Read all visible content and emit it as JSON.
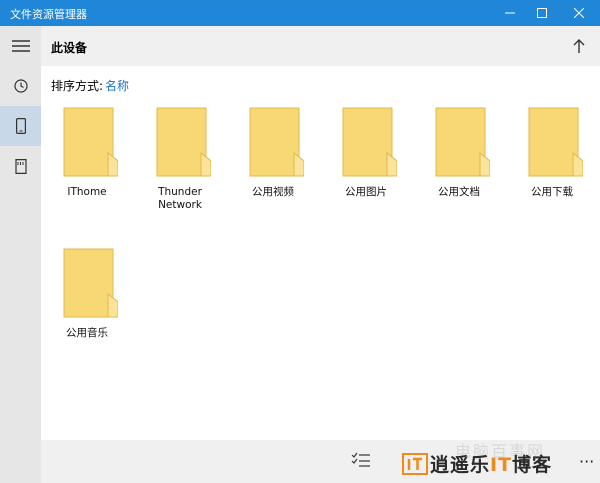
{
  "window": {
    "title": "文件资源管理器",
    "colors": {
      "titlebar": "#1f86d8",
      "accent": "#1a73c9",
      "sidebar": "#e6e6e6",
      "header": "#f0f0f0",
      "folder": "#f8d775"
    }
  },
  "sidebar": {
    "items": [
      {
        "icon": "hamburger-menu-icon"
      },
      {
        "icon": "clock-icon"
      },
      {
        "icon": "phone-icon",
        "active": true
      },
      {
        "icon": "sd-card-icon"
      }
    ]
  },
  "header": {
    "title": "此设备"
  },
  "sort": {
    "label": "排序方式:",
    "value": "名称"
  },
  "folders": [
    {
      "name": "IThome"
    },
    {
      "name": "Thunder Network"
    },
    {
      "name": "公用视频"
    },
    {
      "name": "公用图片"
    },
    {
      "name": "公用文档"
    },
    {
      "name": "公用下载"
    },
    {
      "name": "公用音乐"
    }
  ],
  "watermark": {
    "brand_it": "IT",
    "brand_rest": "逍遥乐",
    "brand_it2": "IT",
    "brand_tail": "博客",
    "faint": "电脑百事网"
  }
}
